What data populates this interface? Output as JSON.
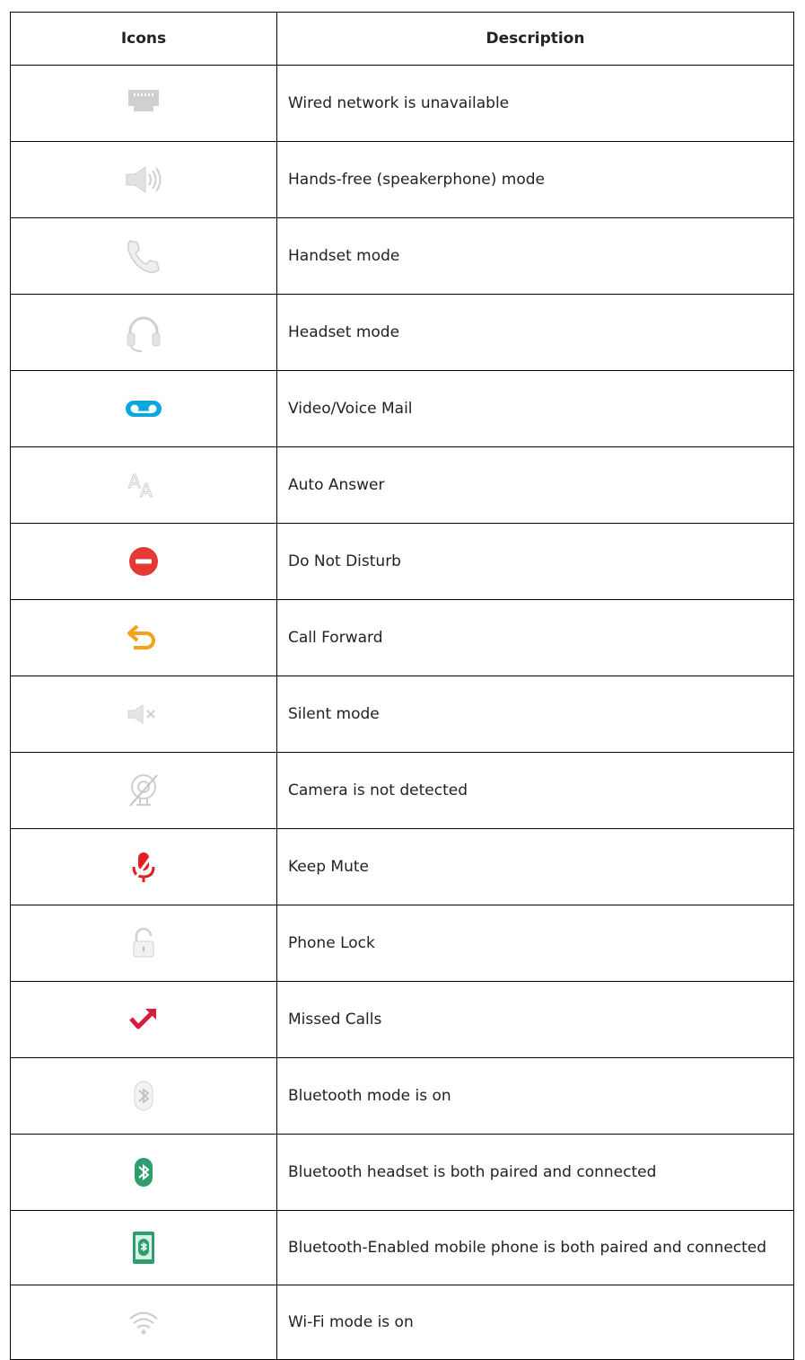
{
  "table": {
    "headers": {
      "icons": "Icons",
      "description": "Description"
    },
    "rows": [
      {
        "icon": "wired-network-unavailable-icon",
        "description": "Wired network is unavailable"
      },
      {
        "icon": "speaker-icon",
        "description": "Hands-free (speakerphone) mode"
      },
      {
        "icon": "handset-icon",
        "description": "Handset mode"
      },
      {
        "icon": "headset-icon",
        "description": "Headset mode"
      },
      {
        "icon": "voicemail-icon",
        "description": "Video/Voice Mail"
      },
      {
        "icon": "auto-answer-icon",
        "description": "Auto Answer"
      },
      {
        "icon": "do-not-disturb-icon",
        "description": "Do Not Disturb"
      },
      {
        "icon": "call-forward-icon",
        "description": "Call Forward"
      },
      {
        "icon": "silent-mode-icon",
        "description": "Silent mode"
      },
      {
        "icon": "camera-not-detected-icon",
        "description": "Camera is not detected"
      },
      {
        "icon": "keep-mute-icon",
        "description": "Keep Mute"
      },
      {
        "icon": "phone-lock-icon",
        "description": "Phone Lock"
      },
      {
        "icon": "missed-calls-icon",
        "description": "Missed Calls"
      },
      {
        "icon": "bluetooth-on-icon",
        "description": "Bluetooth mode is on"
      },
      {
        "icon": "bluetooth-headset-connected-icon",
        "description": "Bluetooth headset is both paired and connected"
      },
      {
        "icon": "bluetooth-mobile-connected-icon",
        "description": "Bluetooth-Enabled mobile phone is both paired and connected"
      },
      {
        "icon": "wifi-on-icon",
        "description": "Wi-Fi mode is on"
      }
    ]
  },
  "colors": {
    "grey_icon": "#c8c8c8",
    "voicemail_blue": "#0aa7e0",
    "dnd_red": "#e53935",
    "forward_orange": "#f4a11c",
    "mute_red": "#e02020",
    "missed_red": "#d81c3c",
    "bluetooth_green": "#2e9e6e"
  }
}
